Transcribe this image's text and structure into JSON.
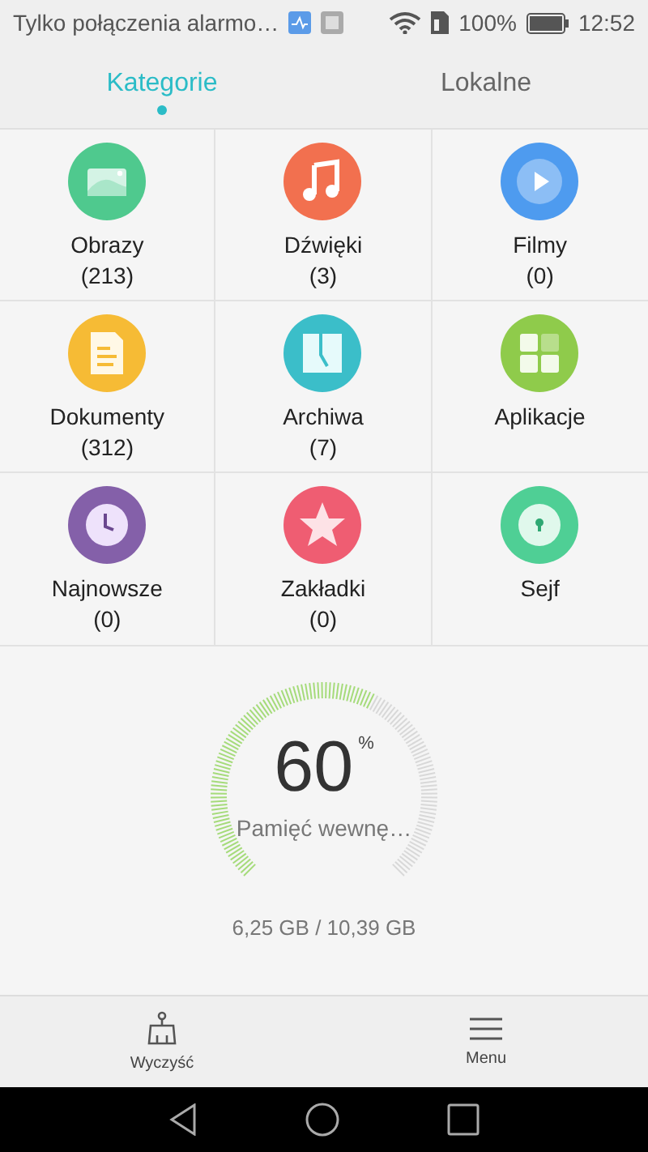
{
  "status_bar": {
    "notification": "Tylko połączenia alarmo…",
    "battery": "100%",
    "time": "12:52"
  },
  "tabs": [
    {
      "label": "Kategorie",
      "selected": true
    },
    {
      "label": "Lokalne",
      "selected": false
    }
  ],
  "categories": [
    {
      "kind": "images",
      "name": "Obrazy",
      "count": "(213)",
      "color": "#4fc98e"
    },
    {
      "kind": "music",
      "name": "Dźwięki",
      "count": "(3)",
      "color": "#f2704f"
    },
    {
      "kind": "video",
      "name": "Filmy",
      "count": "(0)",
      "color": "#4e9bef"
    },
    {
      "kind": "documents",
      "name": "Dokumenty",
      "count": "(312)",
      "color": "#f6bb35"
    },
    {
      "kind": "archives",
      "name": "Archiwa",
      "count": "(7)",
      "color": "#3bbec9"
    },
    {
      "kind": "apps",
      "name": "Aplikacje",
      "color": "#8fcb4b"
    },
    {
      "kind": "recent",
      "name": "Najnowsze",
      "count": "(0)",
      "color": "#8460a9"
    },
    {
      "kind": "favorites",
      "name": "Zakładki",
      "count": "(0)",
      "color": "#ef5d72"
    },
    {
      "kind": "safe",
      "name": "Sejf",
      "color": "#4fcf95"
    }
  ],
  "storage": {
    "percent": "60",
    "unit": "%",
    "label": "Pamięć wewnę…",
    "usage": "6,25 GB / 10,39 GB"
  },
  "bottom_bar": [
    {
      "kind": "clean",
      "label": "Wyczyść"
    },
    {
      "kind": "menu",
      "label": "Menu"
    }
  ]
}
